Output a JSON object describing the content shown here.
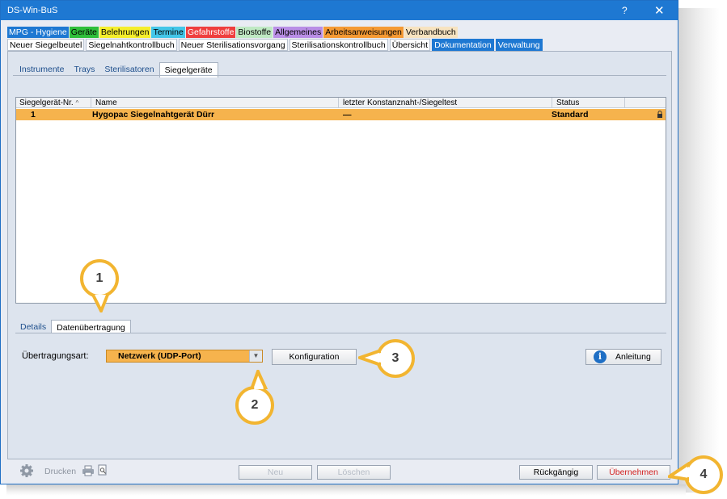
{
  "window": {
    "title": "DS-Win-BuS",
    "help": "?",
    "close": "✕"
  },
  "categories": [
    {
      "label": "MPG - Hygiene",
      "bg": "#1e78d2",
      "fg": "#ffffff"
    },
    {
      "label": "Geräte",
      "bg": "#2fbf3b",
      "fg": "#000000"
    },
    {
      "label": "Belehrungen",
      "bg": "#f5ee2b",
      "fg": "#000000"
    },
    {
      "label": "Termine",
      "bg": "#43c6e8",
      "fg": "#000000"
    },
    {
      "label": "Gefahrstoffe",
      "bg": "#ef3e3e",
      "fg": "#ffffff"
    },
    {
      "label": "Biostoffe",
      "bg": "#bfe9c3",
      "fg": "#000000"
    },
    {
      "label": "Allgemeines",
      "bg": "#b98ee6",
      "fg": "#000000"
    },
    {
      "label": "Arbeitsanweisungen",
      "bg": "#f59a34",
      "fg": "#000000"
    },
    {
      "label": "Verbandbuch",
      "bg": "#f7e3c0",
      "fg": "#000000"
    }
  ],
  "subtabs": [
    {
      "label": "Neuer Siegelbeutel",
      "hl": false
    },
    {
      "label": "Siegelnahtkontrollbuch",
      "hl": false
    },
    {
      "label": "Neuer Sterilisationsvorgang",
      "hl": false
    },
    {
      "label": "Sterilisationskontrollbuch",
      "hl": false
    },
    {
      "label": "Übersicht",
      "hl": false
    },
    {
      "label": "Dokumentation",
      "hl": true
    },
    {
      "label": "Verwaltung",
      "hl": true
    }
  ],
  "inner_tabs": [
    "Instrumente",
    "Trays",
    "Sterilisatoren",
    "Siegelgeräte"
  ],
  "table": {
    "headers": [
      "Siegelgerät-Nr.",
      "Name",
      "letzter Konstanznaht-/Siegeltest",
      "Status"
    ],
    "sort_indicator": "^",
    "rows": [
      {
        "nr": "1",
        "name": "Hygopac Siegelnahtgerät Dürr",
        "test": "—",
        "status": "Standard"
      }
    ]
  },
  "lower_tabs": [
    "Details",
    "Datenübertragung"
  ],
  "transfer": {
    "label": "Übertragungsart:",
    "value": "Netzwerk (UDP-Port)",
    "arrow": "▼",
    "config_button": "Konfiguration",
    "guide_button": "Anleitung",
    "info_glyph": "i"
  },
  "bottom": {
    "print_label": "Drucken",
    "new_button": "Neu",
    "delete_button": "Löschen",
    "undo_button": "Rückgängig",
    "apply_button": "Übernehmen"
  },
  "callouts": [
    "1",
    "2",
    "3",
    "4"
  ]
}
